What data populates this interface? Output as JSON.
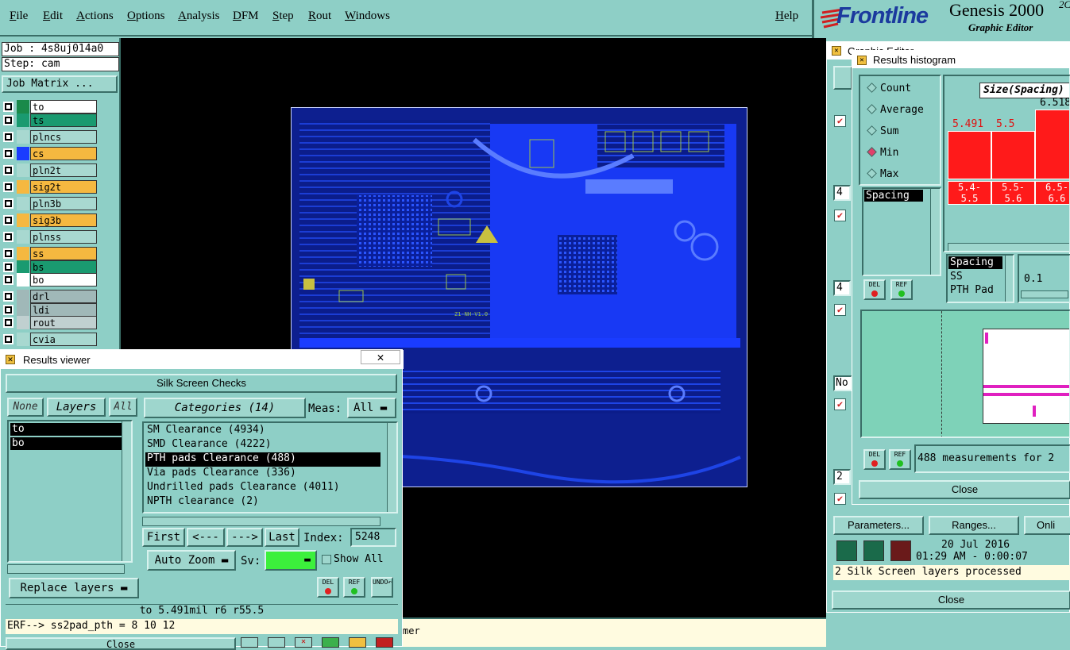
{
  "menu": {
    "items": [
      "File",
      "Edit",
      "Actions",
      "Options",
      "Analysis",
      "DFM",
      "Step",
      "Rout",
      "Windows"
    ],
    "help": "Help"
  },
  "logo": {
    "brand": "Frontline",
    "product": "Genesis 2000",
    "superscript": "2C",
    "subtitle": "Graphic Editor"
  },
  "left": {
    "job": "Job : 4s8uj014a0",
    "step": "Step: cam",
    "job_matrix": "Job Matrix ...",
    "layers": [
      {
        "name": "to",
        "color": "#ffffff",
        "swatch": "#1a8a4a"
      },
      {
        "name": "ts",
        "color": "#1a9a70",
        "swatch": ""
      },
      {
        "name": "plncs",
        "color": "#a8d8d0",
        "swatch": ""
      },
      {
        "name": "cs",
        "color": "#f5b840",
        "swatch": "#1a3cff"
      },
      {
        "name": "pln2t",
        "color": "#a8d8d0",
        "swatch": ""
      },
      {
        "name": "sig2t",
        "color": "#f5b840",
        "swatch": ""
      },
      {
        "name": "pln3b",
        "color": "#a8d8d0",
        "swatch": ""
      },
      {
        "name": "sig3b",
        "color": "#f5b840",
        "swatch": ""
      },
      {
        "name": "plnss",
        "color": "#a8d8d0",
        "swatch": ""
      },
      {
        "name": "ss",
        "color": "#f5b840",
        "swatch": ""
      },
      {
        "name": "bs",
        "color": "#1a9a70",
        "swatch": ""
      },
      {
        "name": "bo",
        "color": "#ffffff",
        "swatch": ""
      },
      {
        "name": "drl",
        "color": "#a0b8b8",
        "swatch": ""
      },
      {
        "name": "ldi",
        "color": "#a0b8b8",
        "swatch": ""
      },
      {
        "name": "rout",
        "color": "#c0d0d0",
        "swatch": ""
      },
      {
        "name": "cvia",
        "color": "#a8d8d0",
        "swatch": ""
      }
    ]
  },
  "board": {
    "label1": "Z1-NH-V1.0"
  },
  "results_viewer": {
    "title": "Results viewer",
    "heading": "Silk Screen Checks",
    "none": "None",
    "layers_btn": "Layers",
    "all": "All",
    "layer_items": [
      "to",
      "bo"
    ],
    "categories_btn": "Categories (14)",
    "meas_label": "Meas:",
    "meas_value": "All",
    "categories": [
      "SM Clearance (4934)",
      "SMD Clearance (4222)",
      "PTH pads Clearance (488)",
      "Via pads Clearance (336)",
      "Undrilled pads Clearance (4011)",
      "NPTH clearance (2)"
    ],
    "nav": {
      "first": "First",
      "prev": "<---",
      "next": "--->",
      "last": "Last",
      "index_label": "Index:",
      "index_value": "5248"
    },
    "auto_zoom": "Auto Zoom",
    "sv_label": "Sv:",
    "show_all": "Show All",
    "replace_layers": "Replace layers",
    "del": "DEL",
    "ref": "REF",
    "undo": "UNDO",
    "measurement": "to 5.491mil  r6  r55.5",
    "erf": "ERF--> ss2pad_pth = 8 10 12",
    "close": "Close"
  },
  "statusbar": {
    "text": "mer"
  },
  "histogram": {
    "title": "Results histogram",
    "modes": [
      "Count",
      "Average",
      "Sum",
      "Min",
      "Max"
    ],
    "selected_mode": "Min",
    "list_item": "Spacing",
    "header": "Size(Spacing)",
    "bars": [
      {
        "label": "5.491",
        "range": "5.4-\n5.5",
        "value": 5.491
      },
      {
        "label": "5.5",
        "range": "5.5-\n5.6",
        "value": 5.5
      },
      {
        "label": "6.518",
        "range": "6.5-\n6.6",
        "value": 6.518
      }
    ],
    "info_lines": [
      "Spacing",
      "SS",
      "PTH Pad"
    ],
    "value": "0.1",
    "measurements": "488 measurements for 2",
    "close": "Close"
  },
  "graphic_params": {
    "title": "Graphic Editor",
    "numbers": [
      "4",
      "4",
      "2"
    ],
    "partial_no": "No",
    "buttons": {
      "parameters": "Parameters...",
      "ranges": "Ranges...",
      "online": "Onli"
    },
    "date": "20 Jul 2016",
    "time": "01:29 AM - 0:00:07",
    "status": "2 Silk Screen layers processed",
    "close": "Close"
  }
}
